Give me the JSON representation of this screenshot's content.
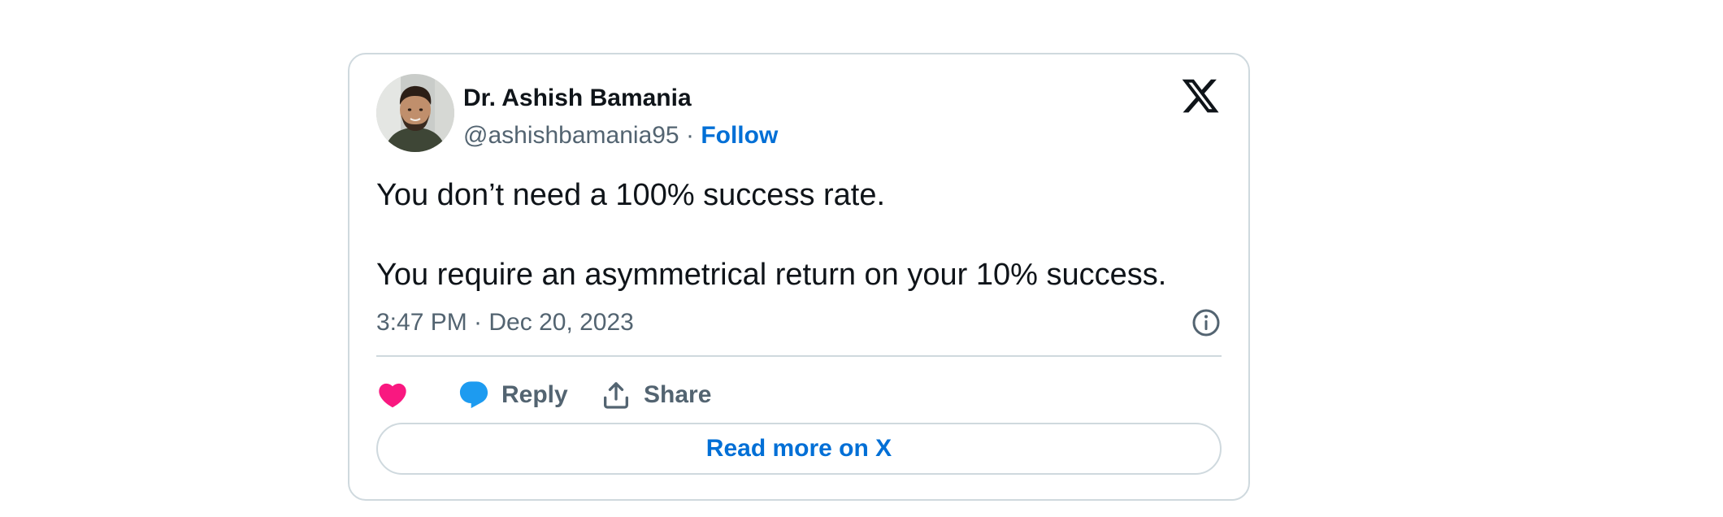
{
  "tweet": {
    "author_name": "Dr. Ashish Bamania",
    "handle": "@ashishbamania95",
    "separator": "·",
    "follow_label": "Follow",
    "text_lines": [
      "You don’t need a 100% success rate.",
      "You require an asymmetrical return on your 10% success."
    ],
    "timestamp": "3:47 PM · Dec 20, 2023"
  },
  "actions": {
    "like_icon": "heart-icon",
    "reply_label": "Reply",
    "reply_icon": "speech-bubble-icon",
    "share_label": "Share",
    "share_icon": "upload-icon"
  },
  "footer": {
    "read_more_label": "Read more on X"
  },
  "colors": {
    "link": "#006fd6",
    "like": "#f91880",
    "reply": "#1d9bf0",
    "secondary_text": "#536471",
    "border": "#cfd9de"
  }
}
